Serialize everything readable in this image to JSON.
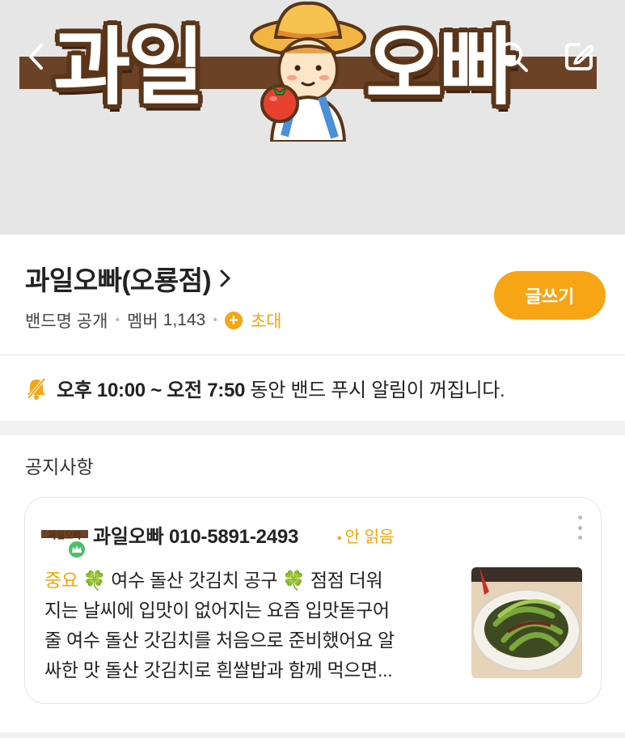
{
  "banner": {
    "logo_left": "과일",
    "logo_right": "오빠",
    "colors": {
      "background": "#e6e6e6",
      "stripe": "#6b4226"
    }
  },
  "header": {
    "back_icon": "chevron-left-icon",
    "search_icon": "search-icon",
    "edit_icon": "edit-icon"
  },
  "band": {
    "name": "과일오빠(오룡점)",
    "visibility": "밴드명 공개",
    "members_label": "멤버",
    "members_count": "1,143",
    "invite_label": "초대",
    "write_button": "글쓰기",
    "accent_color": "#f7a514"
  },
  "push_notice": {
    "start": "오후 10:00",
    "separator": "~",
    "end": "오전 7:50",
    "message": "동안 밴드 푸시 알림이 꺼집니다."
  },
  "notices": {
    "heading": "공지사항",
    "items": [
      {
        "avatar_text": "과일오빠",
        "author": "과일오빠 010-5891-2493",
        "unread": "안 읽음",
        "badge": "중요",
        "clover": "🍀",
        "line1_a": "여수 돌산 갓김치 공구",
        "line1_b": "점점 더워",
        "line2": "지는 날씨에 입맛이 없어지는 요즘 입맛돋구어",
        "line3": "줄 여수 돌산 갓김치를 처음으로 준비했어요 알",
        "line4": "싸한 맛 돌산 갓김치로 흰쌀밥과 함께 먹으면..."
      }
    ]
  }
}
